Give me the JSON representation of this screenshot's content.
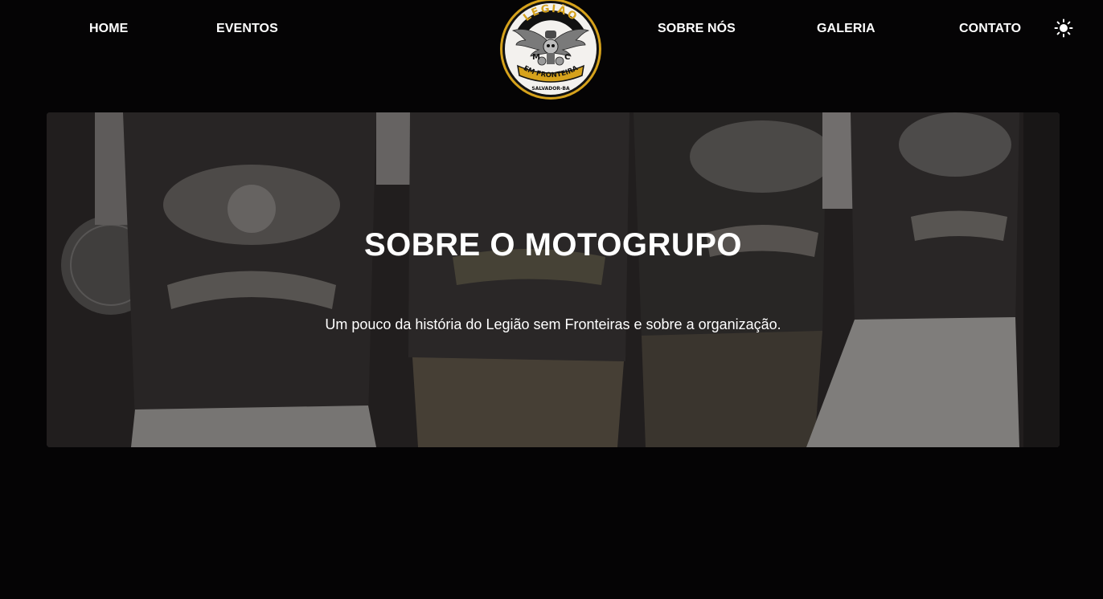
{
  "nav": {
    "home": "HOME",
    "eventos": "EVENTOS",
    "sobre": "SOBRE NÓS",
    "galeria": "GALERIA",
    "contato": "CONTATO",
    "theme_icon": "sun-icon"
  },
  "logo": {
    "top_text": "LEGIÃO",
    "letter_left": "M",
    "letter_right": "C",
    "banner_text": "SEM FRONTEIRAS",
    "bottom_text": "SALVADOR-BA",
    "colors": {
      "gold": "#d6a21c",
      "ring": "#111111",
      "face": "#f3f1ee"
    }
  },
  "hero": {
    "title": "SOBRE O MOTOGRUPO",
    "subtitle": "Um pouco da história do Legião sem Fronteiras e sobre a organização."
  },
  "colors": {
    "background": "#050405",
    "text": "#ffffff"
  }
}
